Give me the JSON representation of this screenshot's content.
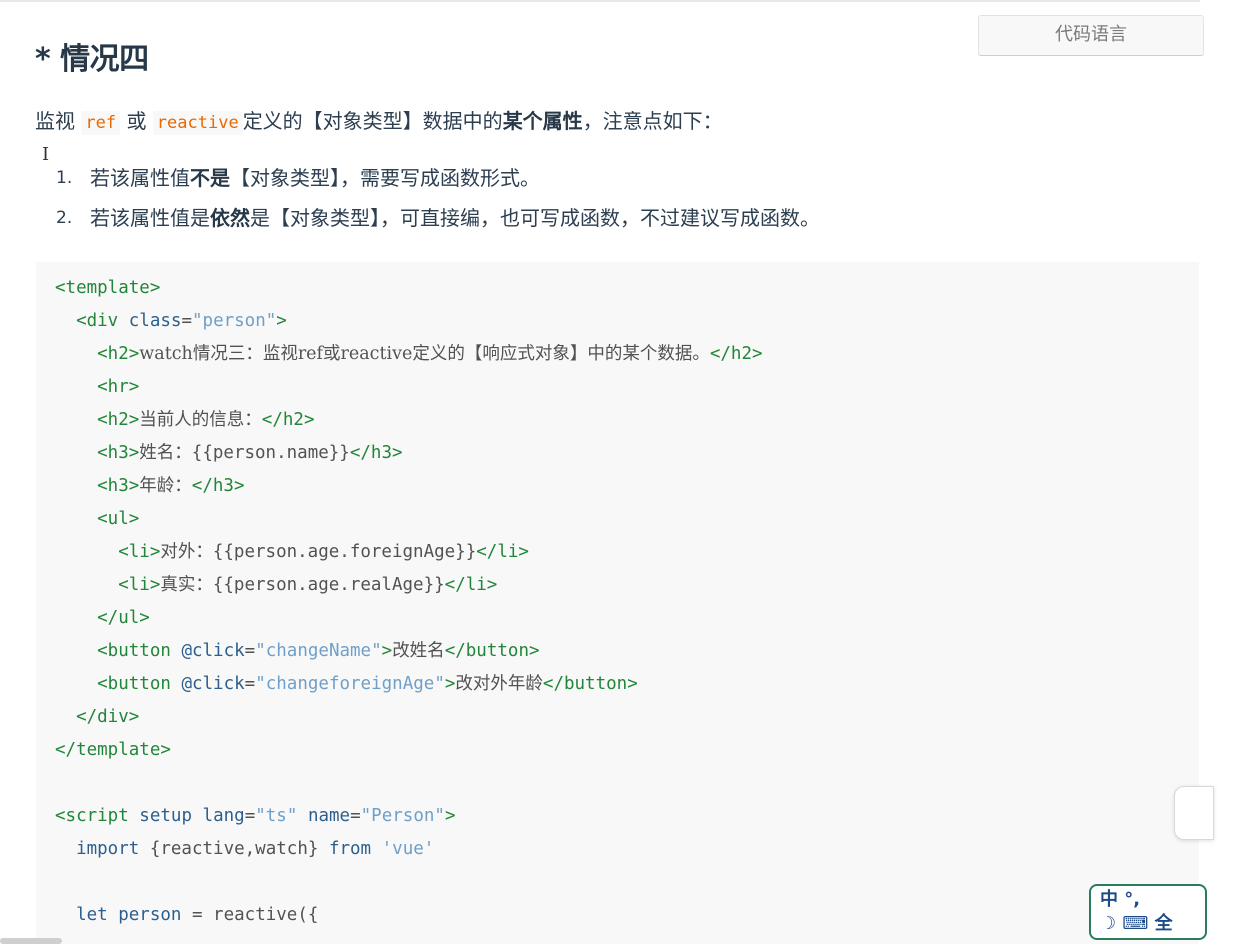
{
  "lang_button": "代码语言",
  "heading": "* 情况四",
  "intro": {
    "p1": "监视",
    "c1": "ref",
    "p2": "或",
    "c2": "reactive",
    "p3": "定义的【对象类型】数据中的",
    "b1": "某个属性",
    "p4": "，注意点如下："
  },
  "points": [
    {
      "num": "1.",
      "a": "若该属性值",
      "b": "不是",
      "c": "【对象类型】，需要写成函数形式。"
    },
    {
      "num": "2.",
      "a": "若该属性值是",
      "b": "依然",
      "c": "是【对象类型】，可直接编，也可写成函数，不过建议写成函数。"
    }
  ],
  "code": {
    "l1": "<template>",
    "l2a": "  <div ",
    "l2b": "class",
    "l2c": "=",
    "l2d": "\"person\"",
    "l2e": ">",
    "l3a": "    <h2>",
    "l3b": "watch情况三：监视ref或reactive定义的【响应式对象】中的某个数据。",
    "l3c": "</h2>",
    "l4": "    <hr>",
    "l5a": "    <h2>",
    "l5b": "当前人的信息：",
    "l5c": "</h2>",
    "l6a": "    <h3>",
    "l6b": "姓名：",
    "l6c": "{{person.name}}",
    "l6d": "</h3>",
    "l7a": "    <h3>",
    "l7b": "年龄：",
    "l7c": "</h3>",
    "l8": "    <ul>",
    "l9a": "      <li>",
    "l9b": "对外：",
    "l9c": "{{person.age.foreignAge}}",
    "l9d": "</li>",
    "l10a": "      <li>",
    "l10b": "真实：",
    "l10c": "{{person.age.realAge}}",
    "l10d": "</li>",
    "l11": "    </ul>",
    "l12a": "    <button ",
    "l12b": "@click",
    "l12c": "=",
    "l12d": "\"changeName\"",
    "l12e": ">",
    "l12f": "改姓名",
    "l12g": "</button>",
    "l13a": "    <button ",
    "l13b": "@click",
    "l13c": "=",
    "l13d": "\"changeforeignAge\"",
    "l13e": ">",
    "l13f": "改对外年龄",
    "l13g": "</button>",
    "l14": "  </div>",
    "l15": "</template>",
    "l16": "",
    "l17a": "<script ",
    "l17b": "setup",
    "l17c": " ",
    "l17d": "lang",
    "l17e": "=",
    "l17f": "\"ts\"",
    "l17g": " ",
    "l17h": "name",
    "l17i": "=",
    "l17j": "\"Person\"",
    "l17k": ">",
    "l18a": "  import ",
    "l18b": "{reactive,watch}",
    "l18c": " from ",
    "l18d": "'vue'",
    "l19": "",
    "l20a": "  let ",
    "l20b": "person",
    "l20c": " = ",
    "l20d": "reactive",
    "l20e": "({"
  },
  "ime": {
    "line1": "中 °, ",
    "line2": "☽ ⌨ 全"
  }
}
